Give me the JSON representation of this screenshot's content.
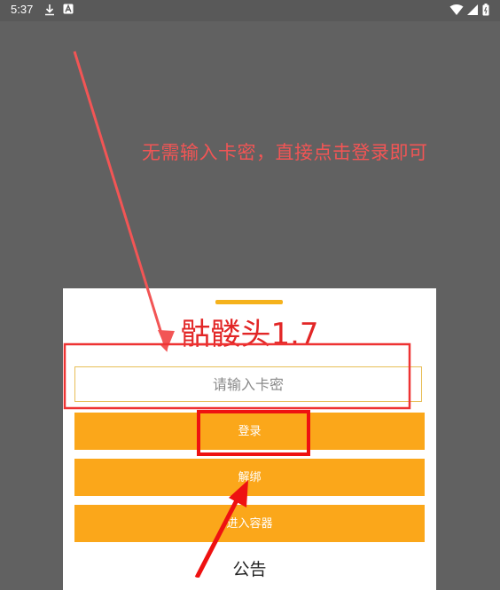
{
  "status_bar": {
    "time": "5:37",
    "left_icons": [
      "download-icon",
      "a-badge-icon"
    ],
    "right_icons": [
      "wifi-icon",
      "signal-icon",
      "battery-icon"
    ]
  },
  "annotation": {
    "text": "无需输入卡密，直接点击登录即可",
    "color": "#f25555"
  },
  "dialog": {
    "title": "骷髅头1.7",
    "input_placeholder": "请输入卡密",
    "input_value": "",
    "buttons": {
      "login": "登录",
      "unbind": "解绑",
      "enter_container": "进入容器"
    },
    "notice_title": "公告"
  },
  "colors": {
    "accent": "#fba71a",
    "title": "#e22626",
    "overlay": "#616161",
    "highlight": "#ee3333"
  }
}
